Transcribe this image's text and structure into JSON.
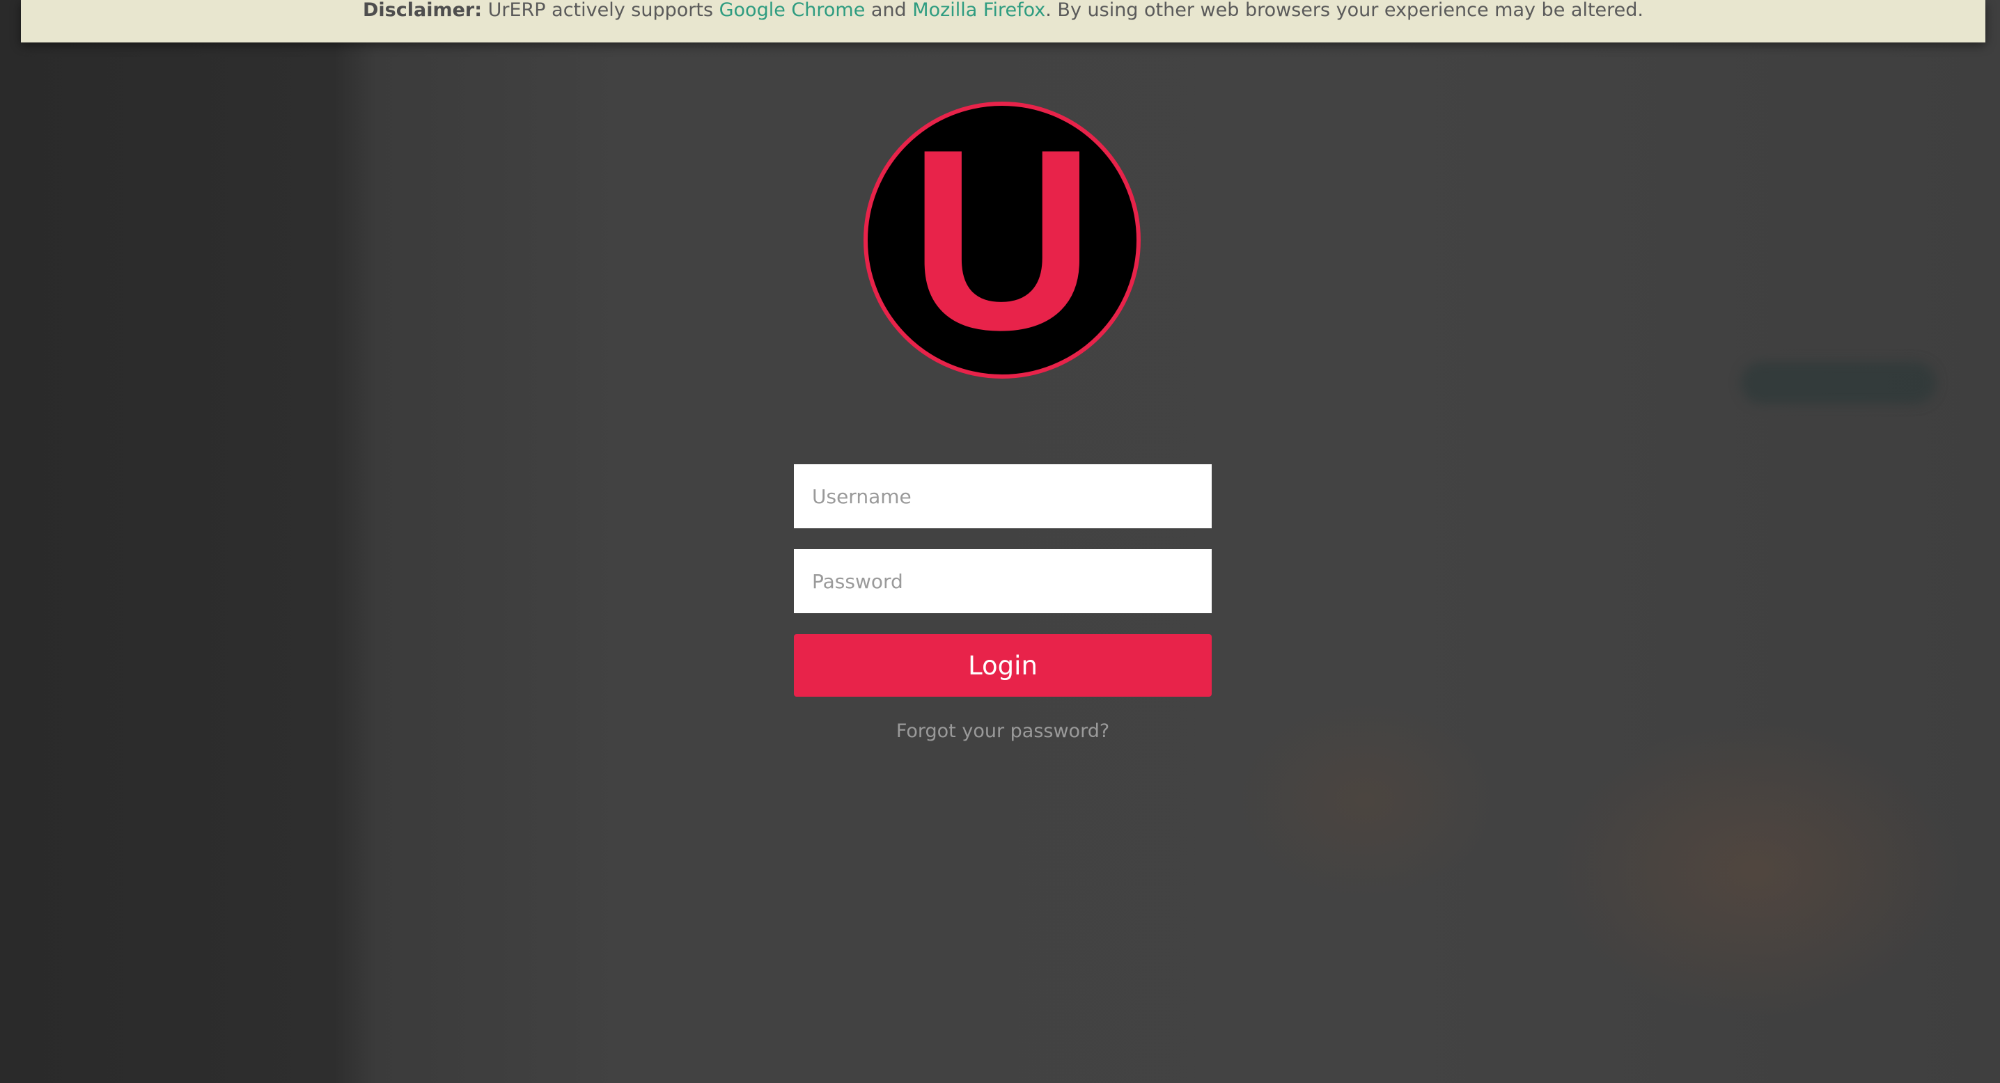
{
  "disclaimer": {
    "label": "Disclaimer:",
    "text_before": " UrERP actively supports ",
    "link_chrome": "Google Chrome",
    "text_middle": " and ",
    "link_firefox": "Mozilla Firefox",
    "text_after": ". By using other web browsers your experience may be altered."
  },
  "logo": {
    "letter": "U",
    "accent_color": "#e8234a",
    "background_color": "#000000"
  },
  "login_form": {
    "username_placeholder": "Username",
    "username_value": "",
    "password_placeholder": "Password",
    "password_value": "",
    "login_label": "Login",
    "forgot_label": "Forgot your password?"
  },
  "colors": {
    "accent": "#e8234a",
    "disclaimer_bg": "#e8e6cf",
    "link": "#2e9c80",
    "page_bg": "#424242"
  }
}
